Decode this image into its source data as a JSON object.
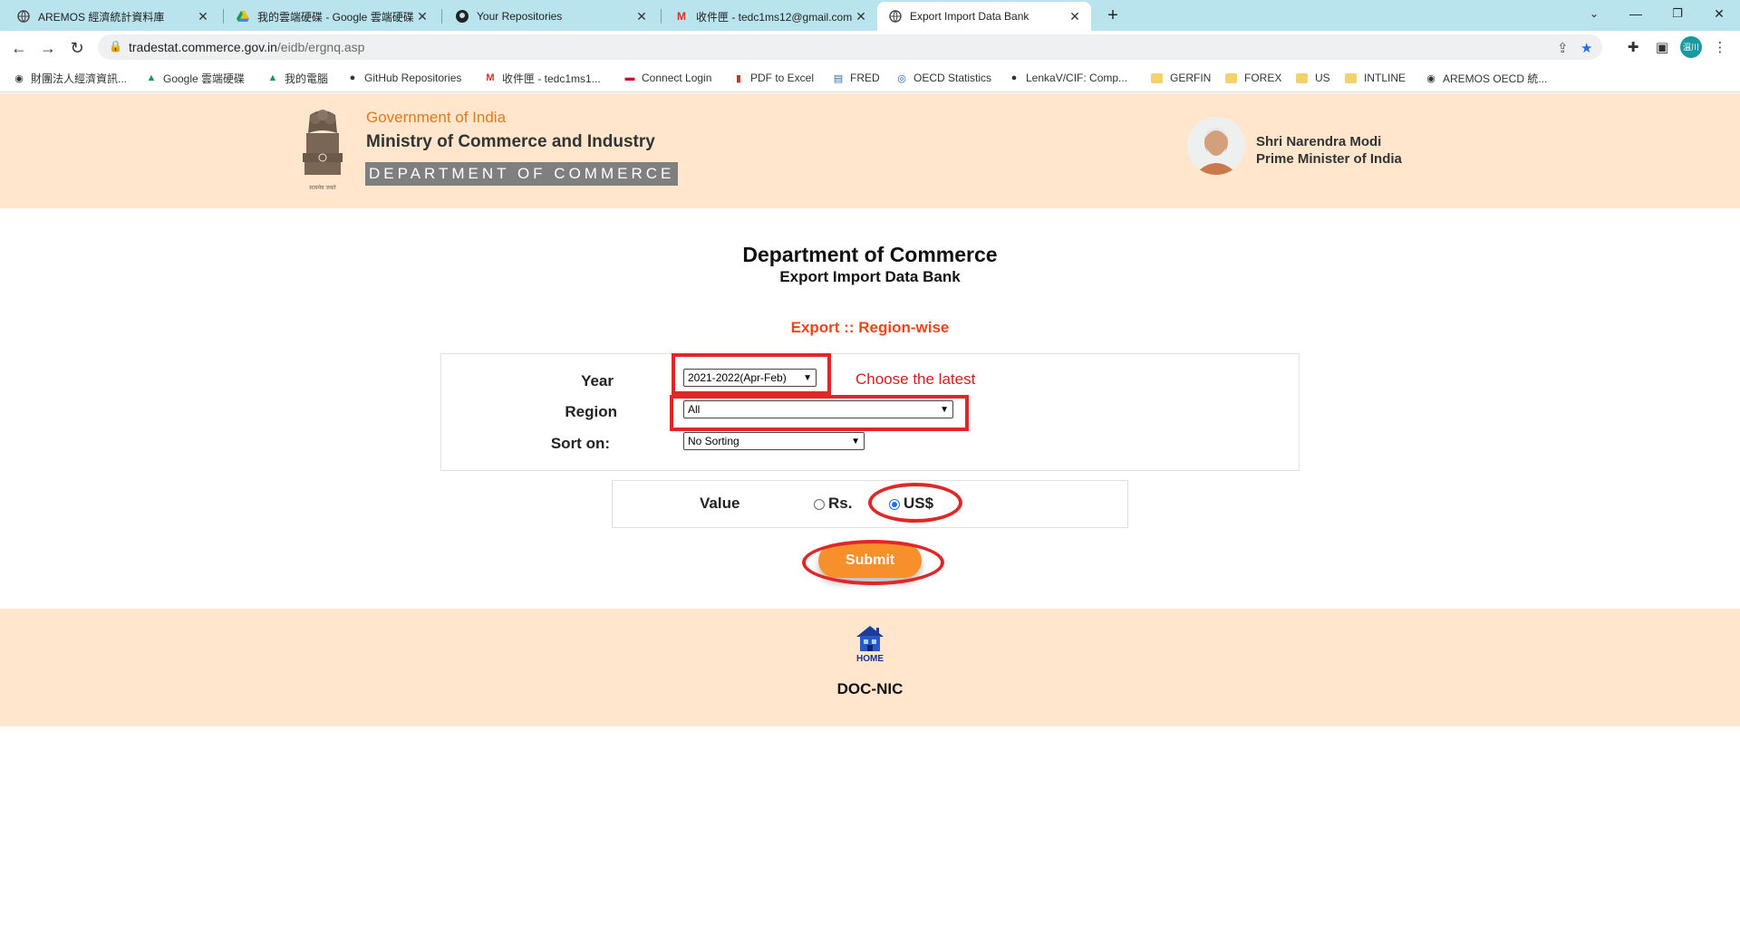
{
  "browser": {
    "tabs": [
      {
        "title": "AREMOS 經濟統計資料庫",
        "icon": "globe-icon"
      },
      {
        "title": "我的雲端硬碟 - Google 雲端硬碟",
        "icon": "google-drive-icon"
      },
      {
        "title": "Your Repositories",
        "icon": "github-icon"
      },
      {
        "title": "收件匣 - tedc1ms12@gmail.com",
        "icon": "gmail-icon"
      },
      {
        "title": "Export Import Data Bank",
        "icon": "globe-icon",
        "active": true
      }
    ],
    "url_host": "tradestat.commerce.gov.in",
    "url_path": "/eidb/ergnq.asp",
    "avatar_text": "溫川",
    "bookmarks": [
      {
        "label": "財團法人經濟資訊...",
        "icon": "globe-icon"
      },
      {
        "label": "Google 雲端硬碟",
        "icon": "google-drive-icon"
      },
      {
        "label": "我的電腦",
        "icon": "google-drive-icon"
      },
      {
        "label": "GitHub Repositories",
        "icon": "github-icon"
      },
      {
        "label": "收件匣 - tedc1ms1...",
        "icon": "gmail-icon"
      },
      {
        "label": "Connect Login",
        "icon": "flag-icon"
      },
      {
        "label": "PDF to Excel",
        "icon": "pdf-icon"
      },
      {
        "label": "FRED",
        "icon": "chart-icon"
      },
      {
        "label": "OECD Statistics",
        "icon": "oecd-icon"
      },
      {
        "label": "LenkaV/CIF: Comp...",
        "icon": "github-icon"
      },
      {
        "label": "GERFIN",
        "icon": "folder-icon"
      },
      {
        "label": "FOREX",
        "icon": "folder-icon"
      },
      {
        "label": "US",
        "icon": "folder-icon"
      },
      {
        "label": "INTLINE",
        "icon": "folder-icon"
      },
      {
        "label": "AREMOS OECD 統...",
        "icon": "globe-icon"
      }
    ]
  },
  "header": {
    "gov": "Government of India",
    "ministry": "Ministry of Commerce and Industry",
    "department": "DEPARTMENT OF COMMERCE",
    "emblem_caption": "सत्यमेव जयते",
    "pm_name": "Shri Narendra Modi",
    "pm_title": "Prime Minister of India"
  },
  "main": {
    "title": "Department of Commerce",
    "subtitle": "Export Import Data Bank",
    "section": "Export :: Region-wise",
    "form": {
      "year_label": "Year",
      "year_value": "2021-2022(Apr-Feb)",
      "year_note": "Choose the latest",
      "region_label": "Region",
      "region_value": "All",
      "sort_label": "Sort on:",
      "sort_value": "No Sorting"
    },
    "value": {
      "label": "Value",
      "option_rs": "Rs.",
      "option_usd": "US$",
      "selected": "US$"
    },
    "submit_label": "Submit"
  },
  "footer": {
    "home_label": "HOME",
    "org": "DOC-NIC"
  },
  "colors": {
    "header_bg": "#ffe6cc",
    "accent_orange": "#e07a21",
    "section_red": "#e8471c",
    "highlight_red": "#e02727",
    "submit_orange": "#f7902a",
    "tabbar": "#b9e4ee"
  }
}
